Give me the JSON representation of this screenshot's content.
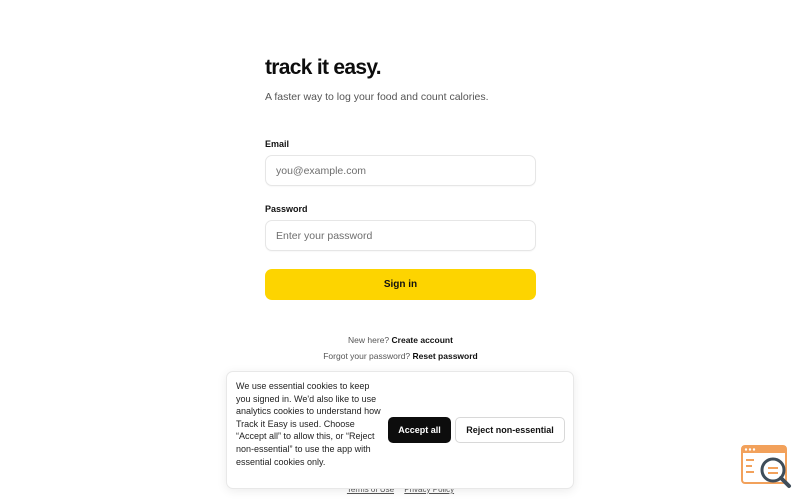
{
  "brand": {
    "title": "track it easy.",
    "tagline": "A faster way to log your food and count calories."
  },
  "form": {
    "email_label": "Email",
    "email_placeholder": "you@example.com",
    "password_label": "Password",
    "password_placeholder": "Enter your password",
    "signin_label": "Sign in"
  },
  "links": {
    "new_here": "New here?",
    "create_account": "Create account",
    "forgot_password": "Forgot your password?",
    "reset_password": "Reset password"
  },
  "footer": {
    "terms": "Terms of Use",
    "privacy": "Privacy Policy"
  },
  "cookie_banner": {
    "message": "We use essential cookies to keep you signed in. We'd also like to use analytics cookies to understand how Track it Easy is used. Choose “Accept all” to allow this, or “Reject non-essential” to use the app with essential cookies only.",
    "accept_label": "Accept all",
    "reject_label": "Reject non-essential"
  },
  "corner_widget": {
    "icon": "search-magnifier-icon"
  },
  "colors": {
    "accent": "#fdd400",
    "dark": "#0d0d0d",
    "widget_accent": "#f2a15b",
    "widget_dark": "#3f4d59"
  }
}
